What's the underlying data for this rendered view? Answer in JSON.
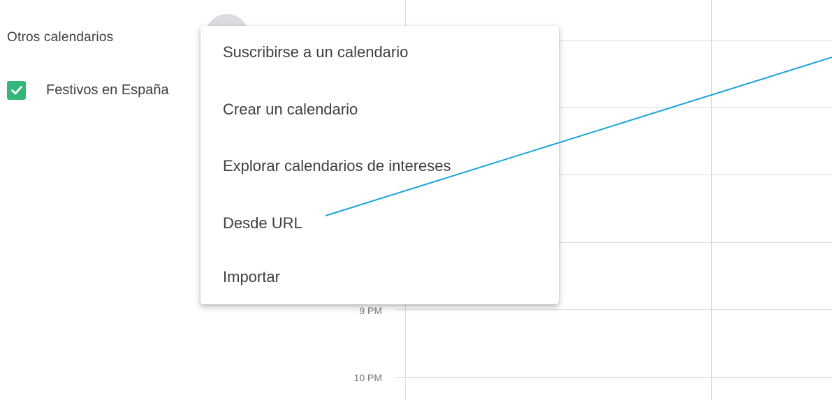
{
  "sidebar": {
    "section_title": "Otros calendarios",
    "calendars": [
      {
        "label": "Festivos en España",
        "checked": true,
        "color": "#33b679"
      }
    ],
    "add_icon": "plus-icon"
  },
  "grid": {
    "time_labels": [
      "9 PM",
      "10 PM"
    ],
    "line_color": "#dadce0"
  },
  "menu": {
    "items": [
      {
        "label": "Suscribirse a un calendario"
      },
      {
        "label": "Crear un calendario"
      },
      {
        "label": "Explorar calendarios de intereses"
      },
      {
        "label": "Desde URL"
      },
      {
        "label": "Importar"
      }
    ]
  },
  "annotation": {
    "color": "#1ba3d8",
    "points_to": "Desde URL"
  }
}
